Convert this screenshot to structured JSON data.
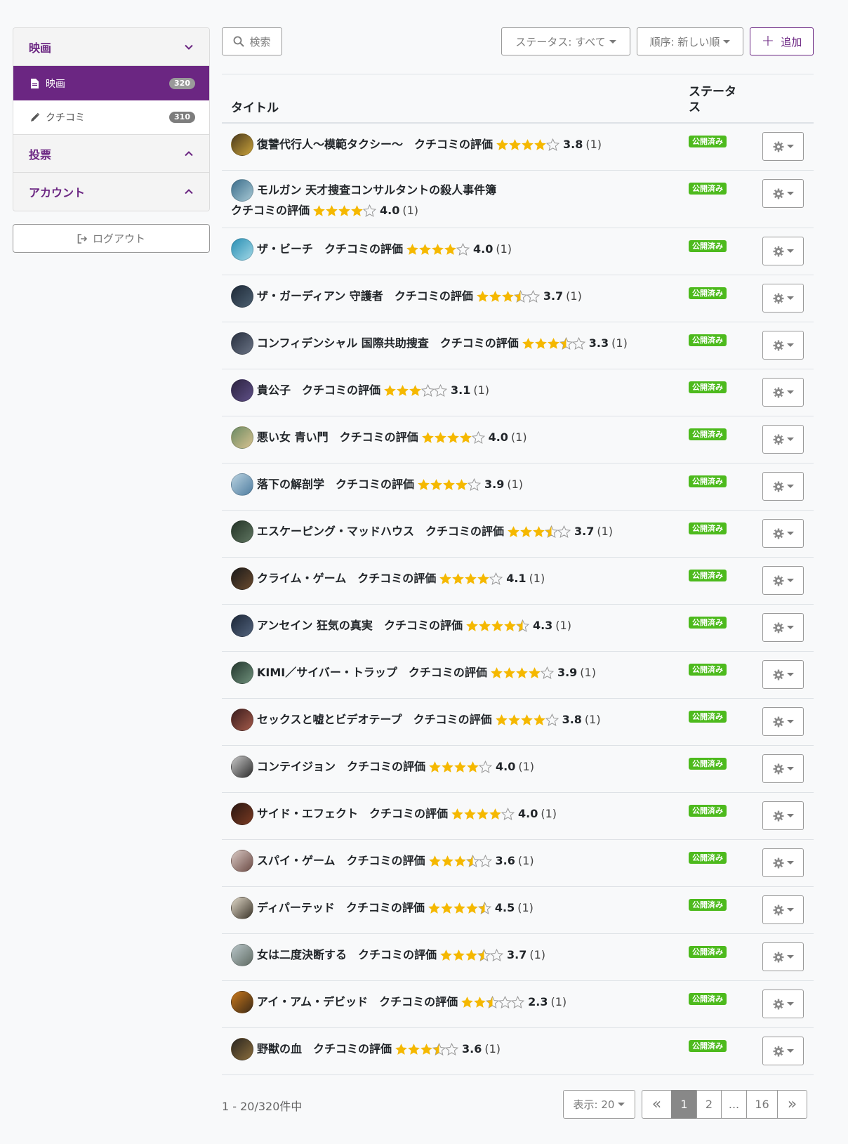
{
  "sidebar": {
    "sections": [
      {
        "label": "映画",
        "expanded": true
      },
      {
        "label": "投票",
        "expanded": false
      },
      {
        "label": "アカウント",
        "expanded": false
      }
    ],
    "items": [
      {
        "label": "映画",
        "count": "320",
        "icon": "document-icon",
        "active": true
      },
      {
        "label": "クチコミ",
        "count": "310",
        "icon": "pencil-icon",
        "active": false
      }
    ],
    "logout_label": "ログアウト"
  },
  "toolbar": {
    "search_label": "検索",
    "status_label": "ステータス: すべて",
    "order_label": "順序: 新しい順",
    "add_label": "追加"
  },
  "table": {
    "headers": {
      "title": "タイトル",
      "status": "ステータス"
    },
    "review_label": "クチコミの評価",
    "status_badge": "公開済み",
    "rows": [
      {
        "title": "復讐代行人〜模範タクシー〜",
        "rating": 3.8,
        "score": "3.8",
        "count": "(1)",
        "thumb": [
          "#4b3a1c",
          "#c9a23a"
        ]
      },
      {
        "title": "モルガン 天才捜査コンサルタントの殺人事件簿",
        "rating": 4.0,
        "score": "4.0",
        "count": "(1)",
        "thumb": [
          "#3c6e8c",
          "#a6c7d3"
        ]
      },
      {
        "title": "ザ・ビーチ",
        "rating": 4.0,
        "score": "4.0",
        "count": "(1)",
        "thumb": [
          "#2a8fb4",
          "#9fd6e5"
        ]
      },
      {
        "title": "ザ・ガーディアン 守護者",
        "rating": 3.7,
        "score": "3.7",
        "count": "(1)",
        "thumb": [
          "#1e2a38",
          "#4c5f70"
        ]
      },
      {
        "title": "コンフィデンシャル 国際共助捜査",
        "rating": 3.3,
        "score": "3.3",
        "count": "(1)",
        "thumb": [
          "#283040",
          "#6a7384"
        ]
      },
      {
        "title": "貴公子",
        "rating": 3.1,
        "score": "3.1",
        "count": "(1)",
        "thumb": [
          "#2c2340",
          "#5e4f86"
        ]
      },
      {
        "title": "悪い女 青い門",
        "rating": 4.0,
        "score": "4.0",
        "count": "(1)",
        "thumb": [
          "#6b8a63",
          "#d7c28f"
        ]
      },
      {
        "title": "落下の解剖学",
        "rating": 3.9,
        "score": "3.9",
        "count": "(1)",
        "thumb": [
          "#b9d2e0",
          "#4f7da0"
        ]
      },
      {
        "title": "エスケーピング・マッドハウス",
        "rating": 3.7,
        "score": "3.7",
        "count": "(1)",
        "thumb": [
          "#233326",
          "#5f7560"
        ]
      },
      {
        "title": "クライム・ゲーム",
        "rating": 4.1,
        "score": "4.1",
        "count": "(1)",
        "thumb": [
          "#1a1a1a",
          "#6a4a2e"
        ]
      },
      {
        "title": "アンセイン 狂気の真実",
        "rating": 4.3,
        "score": "4.3",
        "count": "(1)",
        "thumb": [
          "#1c2738",
          "#52637c"
        ]
      },
      {
        "title": "KIMI／サイバー・トラップ",
        "rating": 3.9,
        "score": "3.9",
        "count": "(1)",
        "thumb": [
          "#23372e",
          "#6e8f7a"
        ]
      },
      {
        "title": "セックスと嘘とビデオテープ",
        "rating": 3.8,
        "score": "3.8",
        "count": "(1)",
        "thumb": [
          "#3b1d1d",
          "#a35a4a"
        ]
      },
      {
        "title": "コンテイジョン",
        "rating": 4.0,
        "score": "4.0",
        "count": "(1)",
        "thumb": [
          "#c8c8c8",
          "#2b2b2b"
        ]
      },
      {
        "title": "サイド・エフェクト",
        "rating": 4.0,
        "score": "4.0",
        "count": "(1)",
        "thumb": [
          "#2a1712",
          "#7a3a22"
        ]
      },
      {
        "title": "スパイ・ゲーム",
        "rating": 3.6,
        "score": "3.6",
        "count": "(1)",
        "thumb": [
          "#d9c9c4",
          "#6b4a44"
        ]
      },
      {
        "title": "ディパーテッド",
        "rating": 4.5,
        "score": "4.5",
        "count": "(1)",
        "thumb": [
          "#e0d8c8",
          "#3a3328"
        ]
      },
      {
        "title": "女は二度決断する",
        "rating": 3.7,
        "score": "3.7",
        "count": "(1)",
        "thumb": [
          "#b9c6c9",
          "#5f6b63"
        ]
      },
      {
        "title": "アイ・アム・デビッド",
        "rating": 2.3,
        "score": "2.3",
        "count": "(1)",
        "thumb": [
          "#c9781c",
          "#3d2a16"
        ]
      },
      {
        "title": "野獣の血",
        "rating": 3.6,
        "score": "3.6",
        "count": "(1)",
        "thumb": [
          "#2a2620",
          "#8a6d3c"
        ]
      }
    ]
  },
  "footer": {
    "range_text": "1 - 20/320件中",
    "per_page_label": "表示: 20",
    "pages": [
      "«",
      "1",
      "2",
      "...",
      "16",
      "»"
    ],
    "current_page": "1"
  },
  "colors": {
    "accent": "#6b2682",
    "published": "#4dba1d",
    "star": "#f5b800"
  }
}
